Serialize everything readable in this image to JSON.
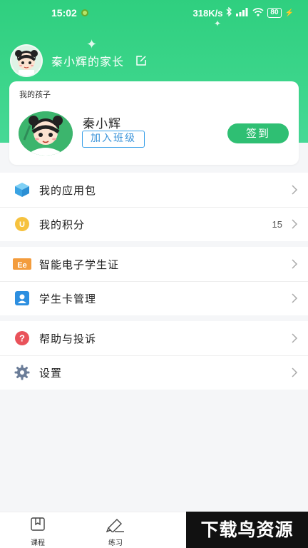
{
  "status_bar": {
    "time": "15:02",
    "network_speed": "318K/s",
    "battery": "80"
  },
  "profile": {
    "parent_name": "秦小辉的家长"
  },
  "child_card": {
    "title": "我的孩子",
    "child_name": "秦小辉",
    "join_class_label": "加入班级",
    "sign_in_label": "签到"
  },
  "menu": {
    "group1": [
      {
        "label": "我的应用包",
        "icon": "cube-icon"
      },
      {
        "label": "我的积分",
        "icon": "coin-icon",
        "value": "15"
      }
    ],
    "group2": [
      {
        "label": "智能电子学生证",
        "icon": "student-id-icon"
      },
      {
        "label": "学生卡管理",
        "icon": "card-user-icon"
      }
    ],
    "group3": [
      {
        "label": "帮助与投诉",
        "icon": "help-icon"
      },
      {
        "label": "设置",
        "icon": "gear-icon"
      }
    ]
  },
  "bottom_nav": {
    "tabs": [
      {
        "label": "课程",
        "icon": "bookmark-icon"
      },
      {
        "label": "练习",
        "icon": "pencil-icon"
      }
    ]
  },
  "watermark": "下载鸟资源",
  "colors": {
    "header_green": "#34d283",
    "signin_green": "#2fbf73",
    "join_blue": "#3a93d9",
    "background": "#f5f6f8"
  }
}
